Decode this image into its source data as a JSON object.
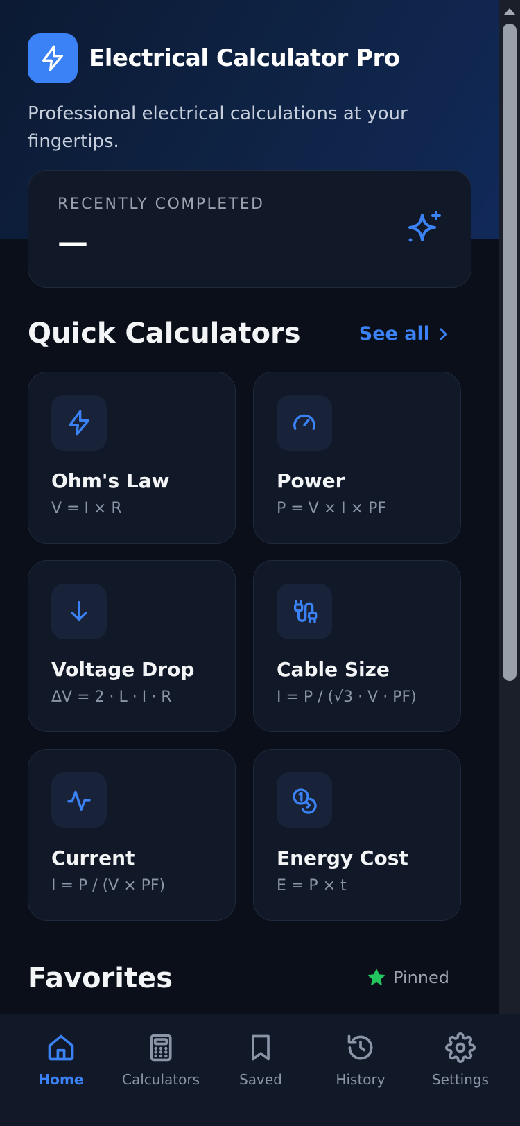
{
  "app": {
    "title": "Electrical Calculator Pro",
    "subtitle": "Professional electrical calculations at your fingertips."
  },
  "recent": {
    "label": "RECENTLY COMPLETED",
    "value": "—"
  },
  "quick": {
    "title": "Quick Calculators",
    "see_all": "See all",
    "cards": [
      {
        "title": "Ohm's Law",
        "formula": "V = I × R",
        "icon": "lightning-icon"
      },
      {
        "title": "Power",
        "formula": "P = V × I × PF",
        "icon": "gauge-icon"
      },
      {
        "title": "Voltage Drop",
        "formula": "ΔV = 2 · L · I · R",
        "icon": "arrow-down-icon"
      },
      {
        "title": "Cable Size",
        "formula": "I = P / (√3 · V · PF)",
        "icon": "cable-icon"
      },
      {
        "title": "Current",
        "formula": "I = P / (V × PF)",
        "icon": "activity-icon"
      },
      {
        "title": "Energy Cost",
        "formula": "E = P × t",
        "icon": "coins-icon"
      }
    ]
  },
  "favorites": {
    "title": "Favorites",
    "pinned": "Pinned"
  },
  "nav": {
    "items": [
      {
        "label": "Home",
        "icon": "home-icon",
        "active": true
      },
      {
        "label": "Calculators",
        "icon": "calculator-icon",
        "active": false
      },
      {
        "label": "Saved",
        "icon": "bookmark-icon",
        "active": false
      },
      {
        "label": "History",
        "icon": "history-icon",
        "active": false
      },
      {
        "label": "Settings",
        "icon": "gear-icon",
        "active": false
      }
    ]
  },
  "colors": {
    "accent": "#3b82f6",
    "background": "#0a0f1a",
    "card": "#111827",
    "pinned_star": "#22c55e"
  }
}
